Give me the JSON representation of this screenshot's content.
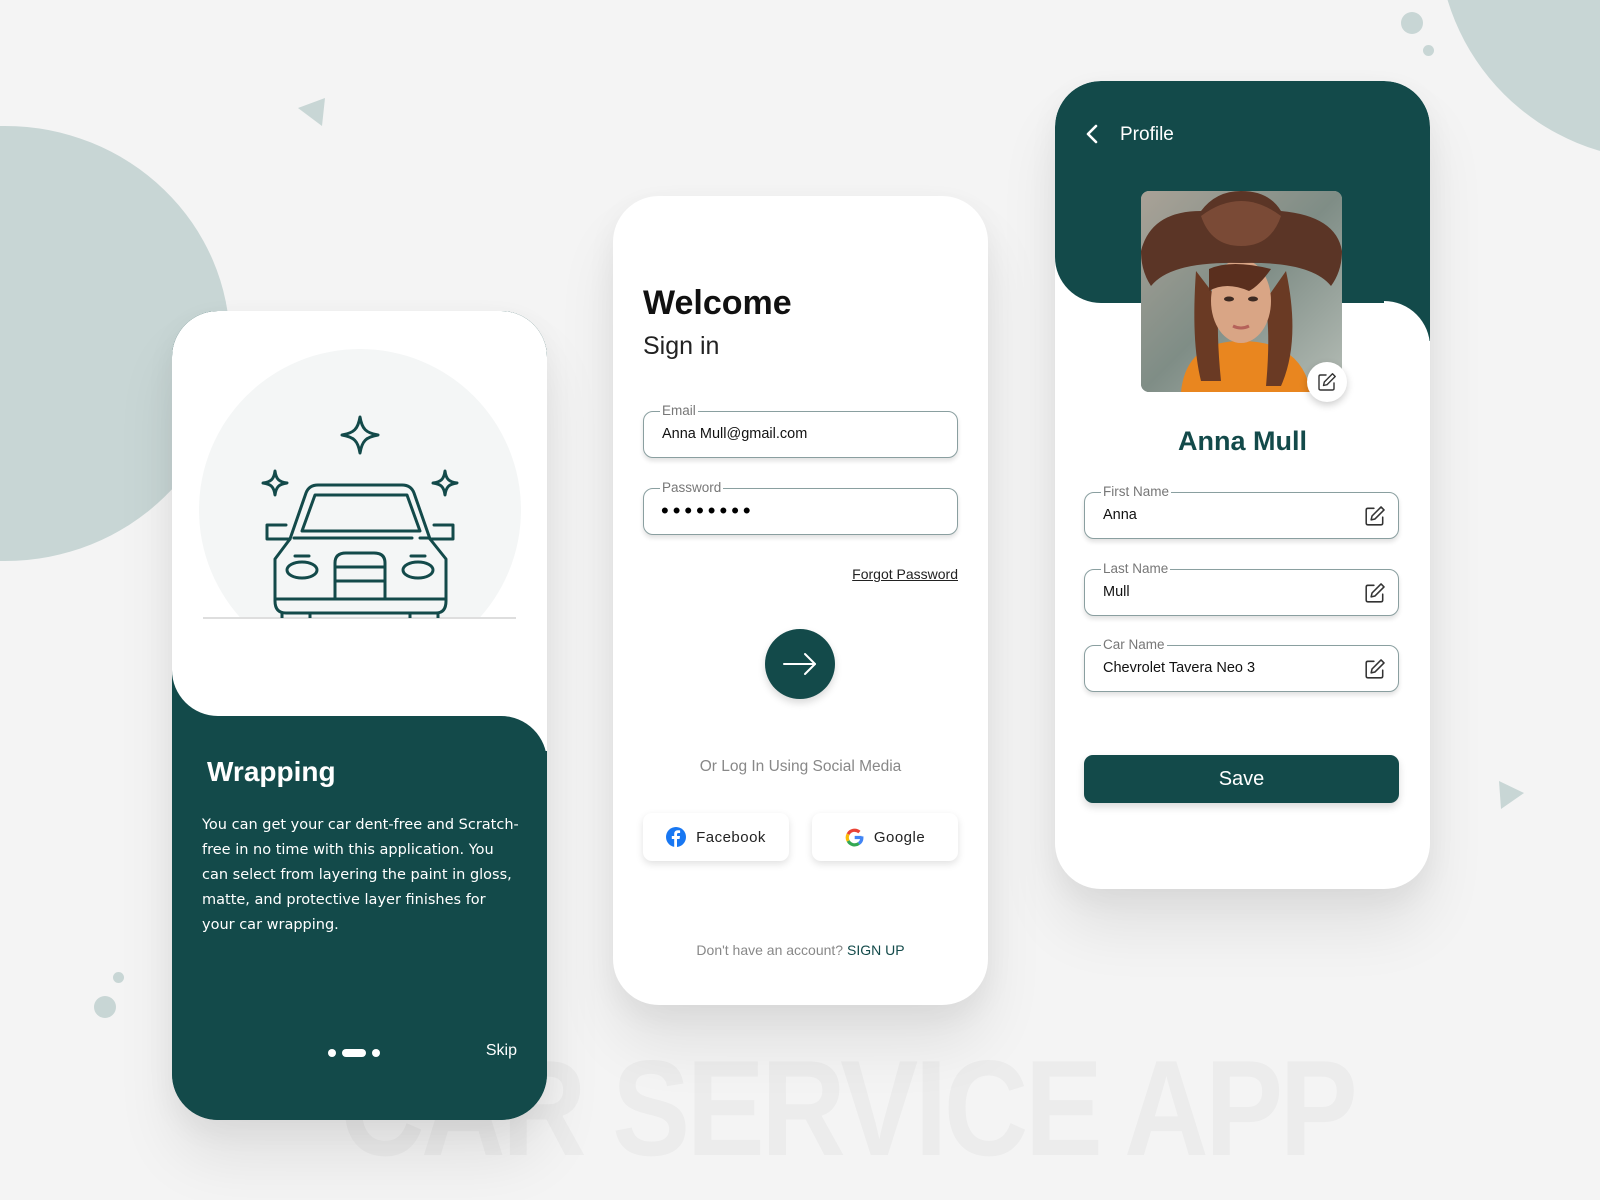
{
  "watermark": "CAR SERVICE APP",
  "colors": {
    "primary": "#134a4a",
    "accent_bg": "#c8d6d5",
    "background": "#f4f4f4"
  },
  "onboarding": {
    "illustration": "car-sparkle-icon",
    "title": "Wrapping",
    "description": "You can get your car dent-free and Scratch-free in no time with this application. You can select from layering the paint in gloss, matte, and protective layer finishes for your car wrapping.",
    "pager": {
      "pages": 3,
      "active_index": 1
    },
    "skip_label": "Skip"
  },
  "signin": {
    "title": "Welcome",
    "subtitle": "Sign in",
    "email": {
      "label": "Email",
      "value": "Anna Mull@gmail.com"
    },
    "password": {
      "label": "Password",
      "masked_value": "••••••••"
    },
    "forgot_label": "Forgot Password",
    "submit_icon": "arrow-right-icon",
    "social_caption": "Or Log In Using Social Media",
    "social": [
      {
        "label": "Facebook",
        "icon": "facebook-icon"
      },
      {
        "label": "Google",
        "icon": "google-icon"
      }
    ],
    "signup_prompt": "Don't have an account?",
    "signup_label": "SIGN UP"
  },
  "profile": {
    "title": "Profile",
    "back_icon": "chevron-left-icon",
    "name": "Anna Mull",
    "fields": [
      {
        "label": "First Name",
        "value": "Anna"
      },
      {
        "label": "Last Name",
        "value": "Mull"
      },
      {
        "label": "Car Name",
        "value": "Chevrolet Tavera Neo 3"
      }
    ],
    "save_label": "Save"
  }
}
